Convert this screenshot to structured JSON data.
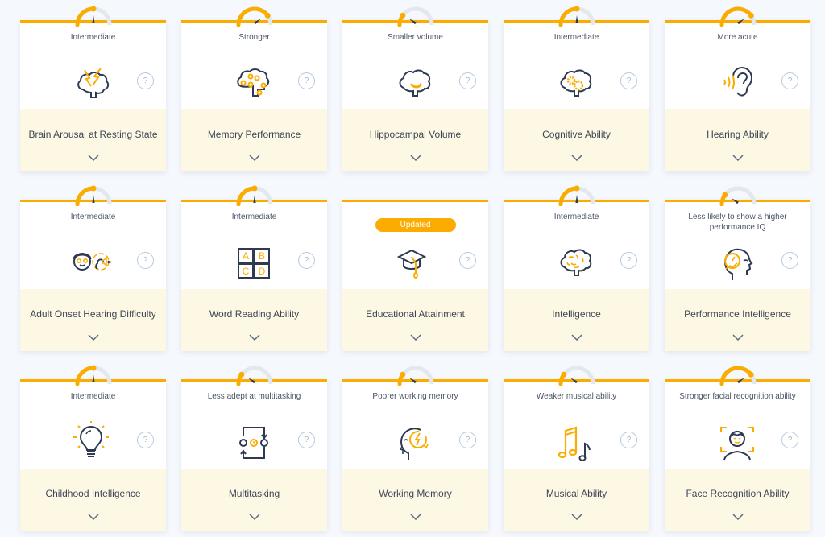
{
  "colors": {
    "accent": "#fbac00",
    "ink": "#2d3a52",
    "footer_bg": "#fdf8e4",
    "gauge_track": "#e3e8ef"
  },
  "help_label": "?",
  "cards": [
    {
      "title": "Brain Arousal at Resting State",
      "status": "Intermediate",
      "gauge_level": 0.5,
      "icon": "brain-lightning-icon"
    },
    {
      "title": "Memory Performance",
      "status": "Stronger",
      "gauge_level": 0.8,
      "icon": "brain-circuit-icon"
    },
    {
      "title": "Hippocampal Volume",
      "status": "Smaller volume",
      "gauge_level": 0.2,
      "icon": "brain-hippocampus-icon"
    },
    {
      "title": "Cognitive Ability",
      "status": "Intermediate",
      "gauge_level": 0.5,
      "icon": "brain-gears-icon"
    },
    {
      "title": "Hearing Ability",
      "status": "More acute",
      "gauge_level": 0.8,
      "icon": "ear-soundwave-icon"
    },
    {
      "title": "Adult Onset Hearing Difficulty",
      "status": "Intermediate",
      "gauge_level": 0.5,
      "icon": "elder-hearing-loss-icon"
    },
    {
      "title": "Word Reading Ability",
      "status": "Intermediate",
      "gauge_level": 0.5,
      "icon": "abcd-blocks-icon"
    },
    {
      "title": "Educational Attainment",
      "status": "",
      "badge": "Updated",
      "gauge_level": null,
      "icon": "graduation-cap-icon"
    },
    {
      "title": "Intelligence",
      "status": "Intermediate",
      "gauge_level": 0.5,
      "icon": "brain-icon"
    },
    {
      "title": "Performance Intelligence",
      "status": "Less likely to show a higher performance IQ",
      "gauge_level": 0.2,
      "icon": "head-speedometer-icon"
    },
    {
      "title": "Childhood Intelligence",
      "status": "Intermediate",
      "gauge_level": 0.5,
      "icon": "lightbulb-icon"
    },
    {
      "title": "Multitasking",
      "status": "Less adept at multitasking",
      "gauge_level": 0.2,
      "icon": "multitask-cycle-icon"
    },
    {
      "title": "Working Memory",
      "status": "Poorer working memory",
      "gauge_level": 0.2,
      "icon": "head-lightning-icon"
    },
    {
      "title": "Musical Ability",
      "status": "Weaker musical ability",
      "gauge_level": 0.2,
      "icon": "music-notes-icon"
    },
    {
      "title": "Face Recognition Ability",
      "status": "Stronger facial recognition ability",
      "gauge_level": 0.8,
      "icon": "face-scan-icon"
    }
  ]
}
